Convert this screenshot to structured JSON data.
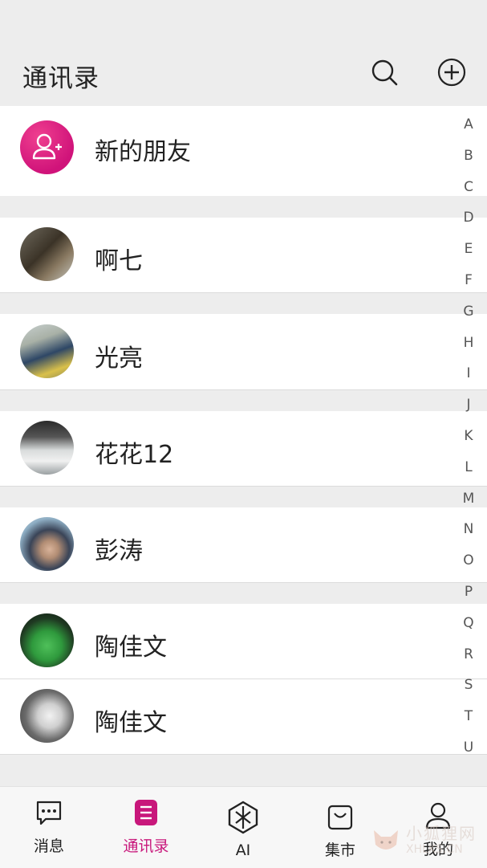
{
  "header": {
    "title": "通讯录",
    "search_icon": "search-icon",
    "add_icon": "plus-circle-icon"
  },
  "new_friends": {
    "label": "新的朋友",
    "icon": "add-user-icon",
    "color": "#d0137a"
  },
  "contacts": [
    {
      "name": "啊七"
    },
    {
      "name": "光亮"
    },
    {
      "name": "花花12"
    },
    {
      "name": "彭涛"
    },
    {
      "name": "陶佳文"
    },
    {
      "name": "陶佳文"
    }
  ],
  "index_letters": [
    "A",
    "B",
    "C",
    "D",
    "E",
    "F",
    "G",
    "H",
    "I",
    "J",
    "K",
    "L",
    "M",
    "N",
    "O",
    "P",
    "Q",
    "R",
    "S",
    "T",
    "U"
  ],
  "tabs": [
    {
      "label": "消息",
      "icon": "chat-bubble-icon",
      "active": false
    },
    {
      "label": "通讯录",
      "icon": "contacts-book-icon",
      "active": true
    },
    {
      "label": "AI",
      "icon": "ai-logo-icon",
      "active": false
    },
    {
      "label": "集市",
      "icon": "shopping-bag-icon",
      "active": false
    },
    {
      "label": "我的",
      "icon": "person-icon",
      "active": false
    }
  ],
  "watermark": {
    "line1": "小狐狸网",
    "line2": "XHLKS.CN"
  },
  "colors": {
    "accent": "#c8177b",
    "background": "#ededed"
  }
}
